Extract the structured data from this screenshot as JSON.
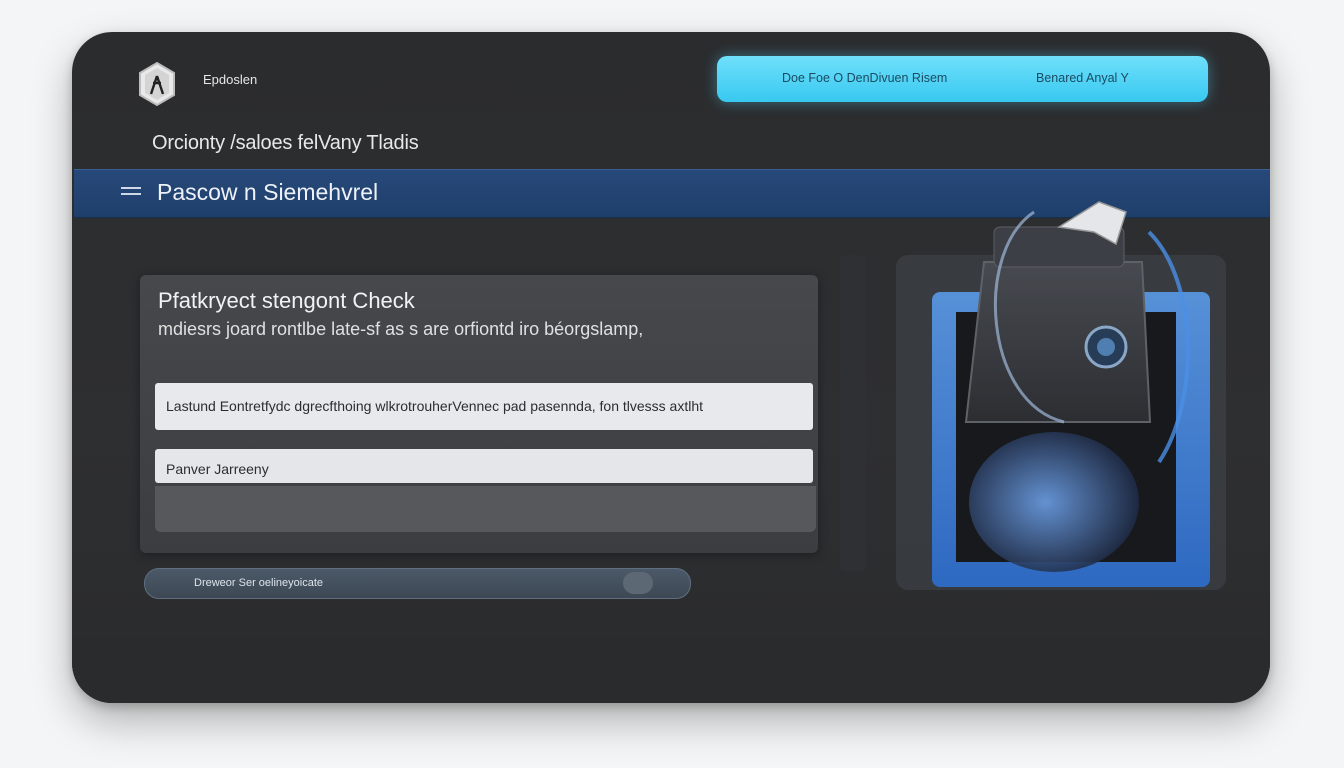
{
  "header": {
    "brand": "Epdoslen",
    "subtitle": "Orcionty /saloes felVany Tladis"
  },
  "top_bar": {
    "left_text": "Doe Foe O DenDivuen Risem",
    "right_text": "Benared Anyal Y"
  },
  "nav": {
    "title": "Pascow n Siemehvrel"
  },
  "panel": {
    "title": "Pfatkryect stengont Check",
    "description": "mdiesrs joard rontlbe late-sf as s are orfiontd iro  béorgslamp,",
    "field1": "Lastund Eontretfydc dgrecfthoing wlkrotrouherVennec pad pasennda, fon tlvesss axtlht",
    "field2": "Panver Jarreeny",
    "field3": ""
  },
  "toggle": {
    "label": "Dreweor Ser oelineyoicate"
  },
  "colors": {
    "accent_cyan": "#38c8f0",
    "nav_blue": "#23457a",
    "window_bg": "#2b2c2e",
    "art_blue": "#3a7fe0"
  },
  "icons": {
    "logo": "hexagon-lambda-logo",
    "menu": "hamburger-menu-icon"
  }
}
